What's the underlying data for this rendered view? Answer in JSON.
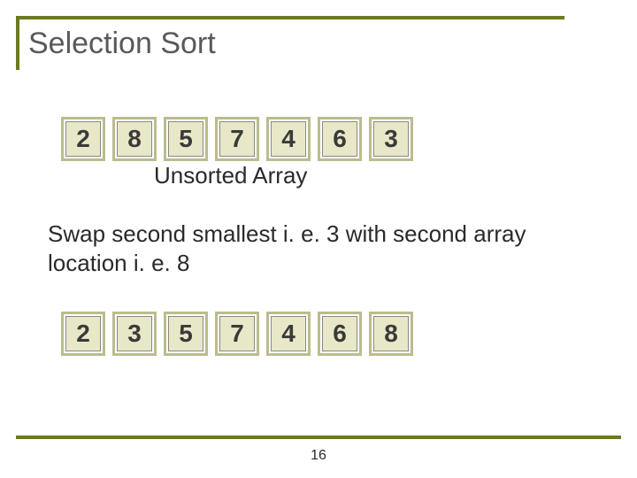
{
  "title": "Selection Sort",
  "array1": [
    "2",
    "8",
    "5",
    "7",
    "4",
    "6",
    "3"
  ],
  "label1": "Unsorted Array",
  "description": "Swap second smallest i. e. 3 with second array location i. e. 8",
  "array2": [
    "2",
    "3",
    "5",
    "7",
    "4",
    "6",
    "8"
  ],
  "page_number": "16"
}
